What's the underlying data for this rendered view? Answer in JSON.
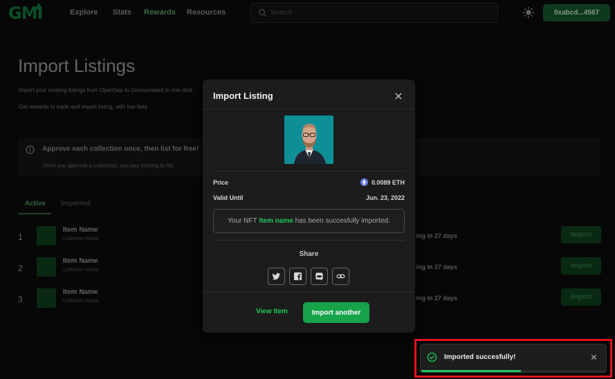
{
  "header": {
    "logo": "GMI",
    "nav": [
      "Explore",
      "Stats",
      "Rewards",
      "Resources"
    ],
    "search_placeholder": "Search",
    "wallet": "0xabcd...4567"
  },
  "page": {
    "title": "Import Listings",
    "description_1": "Import your existing listings from OpenSea to Gonnamakeit in one click.",
    "description_2": "Get rewards to trade and import listing, with low fees",
    "info_title": "Approve each collection once, then list for free!",
    "info_text": "Once you approve a collection, you pay nothing to list.",
    "tabs": [
      "Active",
      "Imported"
    ],
    "rows": [
      {
        "num": "1",
        "name": "Item Name",
        "collection": "Collection Name",
        "expiry": "ring in 27 days",
        "action": "Import"
      },
      {
        "num": "2",
        "name": "Item Name",
        "collection": "Collection Name",
        "expiry": "ring in 27 days",
        "action": "Import"
      },
      {
        "num": "3",
        "name": "Item Name",
        "collection": "Collection Name",
        "expiry": "ring in 27 days",
        "action": "Import"
      }
    ]
  },
  "modal": {
    "title": "Import Listing",
    "price_label": "Price",
    "price_value": "0.0089 ETH",
    "valid_label": "Valid Until",
    "valid_value": "Jun. 23, 2022",
    "status_prefix": "Your NFT",
    "status_item": "Item name",
    "status_suffix": "has been succesfully imported.",
    "share_label": "Share",
    "share_icons": [
      "twitter-icon",
      "facebook-icon",
      "discord-icon",
      "link-icon"
    ],
    "view_item": "View Item",
    "import_another": "Import another"
  },
  "toast": {
    "message": "Imported succesfully!",
    "progress": 0.54
  },
  "colors": {
    "accent": "#22c55e",
    "accent_button": "#16a34a",
    "dim_green": "#0f3f1e",
    "highlight_frame": "#e3131b",
    "nft_background": "#0f8d95"
  }
}
